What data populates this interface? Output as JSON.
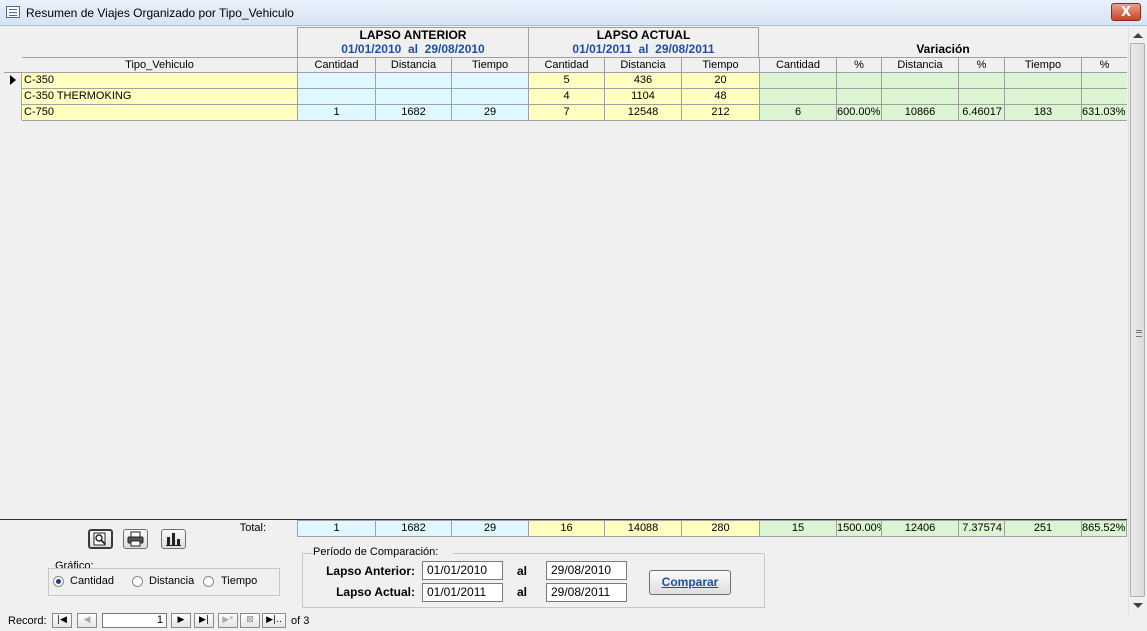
{
  "window": {
    "title": "Resumen de Viajes Organizado por Tipo_Vehiculo",
    "close_glyph": "X"
  },
  "header": {
    "lapso_anterior": {
      "title": "LAPSO ANTERIOR",
      "desde": "01/01/2010",
      "al_word": "al",
      "hasta": "29/08/2010"
    },
    "lapso_actual": {
      "title": "LAPSO ACTUAL",
      "desde": "01/01/2011",
      "al_word": "al",
      "hasta": "29/08/2011"
    },
    "variacion": {
      "title": "Variación"
    },
    "tipo_vehiculo": "Tipo_Vehiculo",
    "cols": [
      "Cantidad",
      "Distancia",
      "Tiempo",
      "Cantidad",
      "Distancia",
      "Tiempo",
      "Cantidad",
      "%",
      "Distancia",
      "%",
      "Tiempo",
      "%"
    ]
  },
  "rows": [
    {
      "tipo": "C-350",
      "a_cant": "",
      "a_dist": "",
      "a_tiempo": "",
      "b_cant": "5",
      "b_dist": "436",
      "b_tiempo": "20",
      "v_cant": "",
      "v_cant_pct": "",
      "v_dist": "",
      "v_dist_pct": "",
      "v_tiempo": "",
      "v_tiempo_pct": ""
    },
    {
      "tipo": "C-350 THERMOKING",
      "a_cant": "",
      "a_dist": "",
      "a_tiempo": "",
      "b_cant": "4",
      "b_dist": "1104",
      "b_tiempo": "48",
      "v_cant": "",
      "v_cant_pct": "",
      "v_dist": "",
      "v_dist_pct": "",
      "v_tiempo": "",
      "v_tiempo_pct": ""
    },
    {
      "tipo": "C-750",
      "a_cant": "1",
      "a_dist": "1682",
      "a_tiempo": "29",
      "b_cant": "7",
      "b_dist": "12548",
      "b_tiempo": "212",
      "v_cant": "6",
      "v_cant_pct": "600.00%",
      "v_dist": "10866",
      "v_dist_pct": "6.46017",
      "v_tiempo": "183",
      "v_tiempo_pct": "631.03%"
    }
  ],
  "totals": {
    "label": "Total:",
    "a_cant": "1",
    "a_dist": "1682",
    "a_tiempo": "29",
    "b_cant": "16",
    "b_dist": "14088",
    "b_tiempo": "280",
    "v_cant": "15",
    "v_cant_pct": "1500.00%",
    "v_dist": "12406",
    "v_dist_pct": "7.37574",
    "v_tiempo": "251",
    "v_tiempo_pct": "865.52%"
  },
  "grafico": {
    "label": "Gráfico:",
    "options": [
      "Cantidad",
      "Distancia",
      "Tiempo"
    ],
    "selected": "Cantidad"
  },
  "periodo": {
    "label": "Período de Comparación:",
    "anterior_label": "Lapso Anterior:",
    "anterior_desde": "01/01/2010",
    "anterior_hasta": "29/08/2010",
    "actual_label": "Lapso Actual:",
    "actual_desde": "01/01/2011",
    "actual_hasta": "29/08/2011",
    "al_word": "al",
    "comparar": "Comparar"
  },
  "navigator": {
    "label": "Record:",
    "current": "1",
    "of_text": "of 3"
  },
  "icons": {
    "preview": "print-preview-icon",
    "print": "printer-icon",
    "chart": "bar-chart-icon"
  }
}
